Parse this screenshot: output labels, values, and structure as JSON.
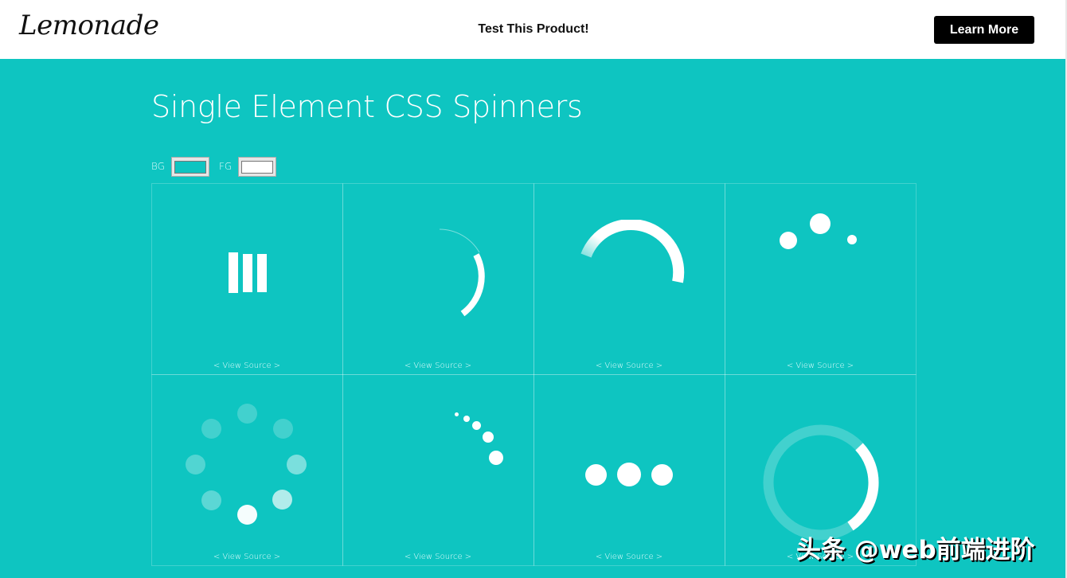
{
  "header": {
    "logo": "Lemonade",
    "promo_text": "Test This Product!",
    "learn_more_label": "Learn More"
  },
  "main": {
    "title": "Single Element CSS Spinners",
    "bg_label": "BG",
    "fg_label": "FG",
    "bg_color": "#0ec5c1",
    "fg_color": "#ffffff"
  },
  "spinners": [
    {
      "name": "bars",
      "link": "< View Source >"
    },
    {
      "name": "thin-arc",
      "link": "< View Source >"
    },
    {
      "name": "gradient-arc",
      "link": "< View Source >"
    },
    {
      "name": "bouncing-dots",
      "link": "< View Source >"
    },
    {
      "name": "circle-dots",
      "link": "< View Source >"
    },
    {
      "name": "trailing-dots",
      "link": "< View Source >"
    },
    {
      "name": "three-dots",
      "link": "< View Source >"
    },
    {
      "name": "ring",
      "link": "< View Source >"
    }
  ],
  "watermark": "头条 @web前端进阶"
}
